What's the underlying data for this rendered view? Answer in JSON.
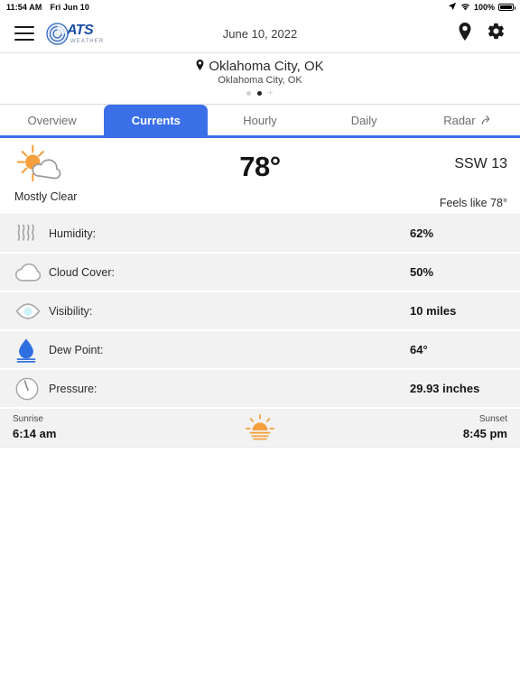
{
  "status_bar": {
    "time": "11:54 AM",
    "date": "Fri Jun 10",
    "battery_percent": "100%",
    "location_icon": "location-arrow-icon",
    "wifi_icon": "wifi-icon",
    "battery_icon": "battery-full-icon"
  },
  "app_bar": {
    "menu_icon": "hamburger-menu-icon",
    "logo_primary": "ATS",
    "logo_secondary": "WEATHER",
    "date": "June 10, 2022",
    "location_icon": "map-pin-icon",
    "settings_icon": "gear-icon"
  },
  "location": {
    "pin_icon": "map-pin-icon",
    "primary": "Oklahoma City, OK",
    "secondary": "Oklahoma City, OK",
    "add_icon": "plus-icon",
    "pages": [
      {
        "active": false
      },
      {
        "active": true
      }
    ]
  },
  "tabs": [
    {
      "label": "Overview",
      "active": false,
      "icon": null
    },
    {
      "label": "Currents",
      "active": true,
      "icon": null
    },
    {
      "label": "Hourly",
      "active": false,
      "icon": null
    },
    {
      "label": "Daily",
      "active": false,
      "icon": null
    },
    {
      "label": "Radar",
      "active": false,
      "icon": "external-link-icon"
    }
  ],
  "current": {
    "condition_icon": "sun-behind-cloud-icon",
    "condition": "Mostly Clear",
    "temperature": "78°",
    "wind": "SSW 13",
    "feels_like": "Feels like 78°"
  },
  "details": [
    {
      "icon": "humidity-waves-icon",
      "label": "Humidity:",
      "value": "62%"
    },
    {
      "icon": "cloud-icon",
      "label": "Cloud Cover:",
      "value": "50%"
    },
    {
      "icon": "eye-icon",
      "label": "Visibility:",
      "value": "10 miles"
    },
    {
      "icon": "water-drop-icon",
      "label": "Dew Point:",
      "value": "64°"
    },
    {
      "icon": "pressure-gauge-icon",
      "label": "Pressure:",
      "value": "29.93 inches"
    }
  ],
  "sun": {
    "sunrise_label": "Sunrise",
    "sunrise_value": "6:14 am",
    "sunset_label": "Sunset",
    "sunset_value": "8:45 pm",
    "icon": "sunrise-icon"
  },
  "colors": {
    "accent_blue": "#3b6fe8",
    "logo_blue": "#1b4fa8",
    "sun_orange": "#f5a03c",
    "row_bg": "#f2f2f2",
    "drop_blue": "#2f6fe0"
  }
}
